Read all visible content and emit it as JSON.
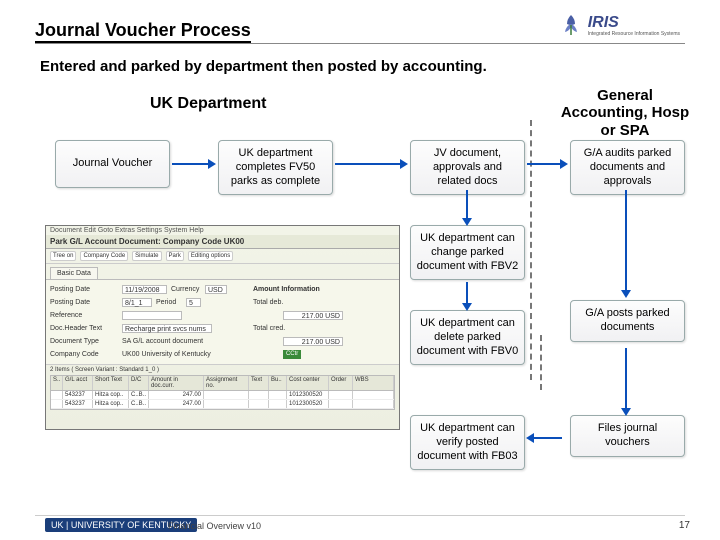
{
  "title": "Journal Voucher Process",
  "subtitle": "Entered and parked by department then posted by accounting.",
  "iris": {
    "label": "IRIS",
    "sub": "Integrated Resource Information Systems"
  },
  "headers": {
    "uk": "UK Department",
    "ga": "General Accounting, Hosp or SPA"
  },
  "boxes": {
    "jv": "Journal Voucher",
    "fv50": "UK department completes FV50 parks as complete",
    "doc": "JV document, approvals and related docs",
    "audit": "G/A audits parked documents and approvals",
    "fbv2": "UK department can change parked document with FBV2",
    "fbv0": "UK department can delete parked document with FBV0",
    "post": "G/A posts parked documents",
    "fb03": "UK department can verify posted document with FB03",
    "file": "Files journal vouchers"
  },
  "sap": {
    "title": "Park G/L Account Document: Company Code UK00",
    "menu": "Document  Edit  Goto  Extras  Settings  System  Help",
    "toolbar": [
      "Tree on",
      "Company Code",
      "Simulate",
      "Park",
      "Editing options"
    ],
    "tab": "Basic Data",
    "fields": {
      "doc_date_label": "Posting Date",
      "doc_date": "11/19/2008",
      "currency_label": "Currency",
      "currency": "USD",
      "posting_date_label": "Posting Date",
      "posting_date": "8/1_1",
      "period_label": "Period",
      "period": "5",
      "ref_label": "Reference",
      "header_label": "Doc.Header Text",
      "header": "Recharge print svcs nums",
      "doctype_label": "Document Type",
      "doctype": "SA    G/L account document",
      "cc_label": "Company Code",
      "cc": "UK00    University of Kentucky",
      "amount_head": "Amount Information",
      "total_deb": "Total deb.",
      "total_cre": "Total cred.",
      "amt1": "217.00  USD",
      "amt2": "217.00  USD",
      "ccx": "CCtr"
    },
    "grid_title": "2 Items ( Screen Variant : Standard 1_0 )",
    "grid_headers": [
      "S..",
      "G/L acct",
      "Short Text",
      "D/C",
      "Amount in doc.curr.",
      "Assignment no.",
      "Text",
      "Bu..",
      "Cost center",
      "Order",
      "WBS"
    ],
    "rows": [
      [
        "",
        "543237",
        "Hitza cop..",
        "C..B..",
        "247.00",
        "",
        "",
        "",
        "1012300520",
        "",
        ""
      ],
      [
        "",
        "543237",
        "Hitza cop..",
        "C..B..",
        "247.00",
        "",
        "",
        "",
        "1012300520",
        "",
        ""
      ]
    ]
  },
  "footer": {
    "logo": "UK | UNIVERSITY OF KENTUCKY",
    "text": "Financial Overview v10",
    "page": "17"
  }
}
